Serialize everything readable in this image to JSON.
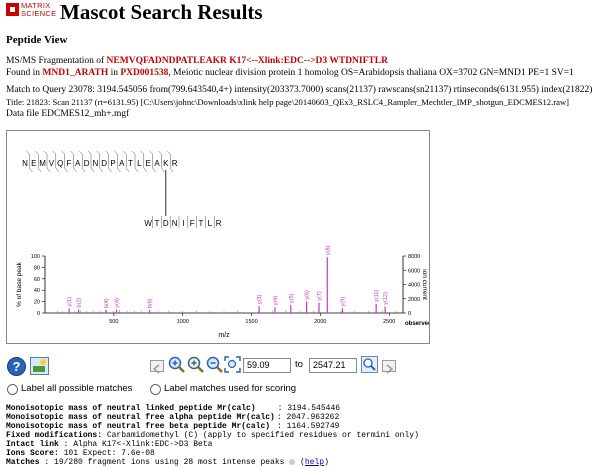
{
  "header": {
    "logo_line1": "MATRIX",
    "logo_line2": "SCIENCE",
    "title": "Mascot Search Results"
  },
  "section_title": "Peptide View",
  "info": {
    "frag_prefix": "MS/MS Fragmentation of ",
    "frag_peptide": "NEMVQFADNDPATLEAKR K17<--Xlink:EDC-->D3 WTDNIFTLR",
    "found_prefix": "Found in ",
    "found_protein": "MND1_ARATH",
    "found_in": " in ",
    "found_acc": "PXD001538",
    "found_desc": ", Meiotic nuclear division protein 1 homolog OS=Arabidopsis thaliana OX=3702 GN=MND1 PE=1 SV=1",
    "query_line": "Match to Query 23078: 3194.545056 from(799.643540,4+) intensity(203373.7000) scans(21137) rawscans(sn21137) rtinseconds(6131.955) index(21822)",
    "title_line": "Title: 21823: Scan 21137 (rt=6131.95) [C:\\Users\\johnc\\Downloads\\xlink help page\\20140603_QEx3_RSLC4_Rampler_Mechtler_IMP_shotgun_EDCMES12.raw]",
    "datafile_line": "Data file EDCMES12_mh+.mgf"
  },
  "sequence": {
    "alpha": [
      "N",
      "E",
      "M",
      "V",
      "Q",
      "F",
      "A",
      "D",
      "N",
      "D",
      "P",
      "A",
      "T",
      "L",
      "E",
      "A",
      "K",
      "R"
    ],
    "beta": [
      "W",
      "T",
      "D",
      "N",
      "I",
      "F",
      "T",
      "L",
      "R"
    ]
  },
  "chart_data": {
    "type": "bar",
    "xlabel": "m/z",
    "ylabel": "% of base peak",
    "y2label": "ion current",
    "y2note": "observed",
    "xlim": [
      0,
      2600
    ],
    "ylim": [
      0,
      100
    ],
    "y2lim": [
      0,
      8000
    ],
    "xticks": [
      500,
      1000,
      1500,
      2000,
      2500
    ],
    "yticks": [
      0,
      20,
      40,
      60,
      80,
      100
    ],
    "y2ticks": [
      0,
      2000,
      4000,
      6000,
      8000
    ],
    "peaks": [
      {
        "x": 90,
        "y": 4
      },
      {
        "x": 130,
        "y": 3
      },
      {
        "x": 175,
        "y": 5
      },
      {
        "x": 215,
        "y": 3
      },
      {
        "x": 260,
        "y": 4
      },
      {
        "x": 300,
        "y": 3
      },
      {
        "x": 350,
        "y": 4
      },
      {
        "x": 400,
        "y": 3
      },
      {
        "x": 440,
        "y": 6
      },
      {
        "x": 500,
        "y": 4
      },
      {
        "x": 540,
        "y": 5
      },
      {
        "x": 600,
        "y": 3
      },
      {
        "x": 650,
        "y": 4
      },
      {
        "x": 700,
        "y": 3
      },
      {
        "x": 760,
        "y": 5
      },
      {
        "x": 820,
        "y": 3
      },
      {
        "x": 900,
        "y": 4
      },
      {
        "x": 1000,
        "y": 3
      },
      {
        "x": 1100,
        "y": 4
      },
      {
        "x": 1200,
        "y": 3
      },
      {
        "x": 1300,
        "y": 3
      },
      {
        "x": 1400,
        "y": 4
      },
      {
        "x": 1550,
        "y": 3
      },
      {
        "x": 1650,
        "y": 4
      },
      {
        "x": 1750,
        "y": 5
      },
      {
        "x": 1850,
        "y": 3
      },
      {
        "x": 1950,
        "y": 4
      },
      {
        "x": 2150,
        "y": 3
      },
      {
        "x": 2250,
        "y": 4
      },
      {
        "x": 2350,
        "y": 3
      },
      {
        "x": 2450,
        "y": 4
      },
      {
        "x": 2550,
        "y": 3
      }
    ],
    "matched": [
      {
        "label": "y(1)",
        "x": 175,
        "y": 8
      },
      {
        "label": "b(2)",
        "x": 244,
        "y": 6
      },
      {
        "label": "b(4)",
        "x": 444,
        "y": 5
      },
      {
        "label": "y(4)",
        "x": 520,
        "y": 6
      },
      {
        "label": "b(6)",
        "x": 760,
        "y": 5
      },
      {
        "label": "y(3)",
        "x": 1555,
        "y": 12
      },
      {
        "label": "y(4)",
        "x": 1670,
        "y": 10
      },
      {
        "label": "y(5)",
        "x": 1785,
        "y": 14
      },
      {
        "label": "y(6)",
        "x": 1900,
        "y": 20
      },
      {
        "label": "y(7)",
        "x": 1990,
        "y": 18
      },
      {
        "label": "y(8)",
        "x": 2050,
        "y": 98
      },
      {
        "label": "y(9)",
        "x": 2160,
        "y": 8
      },
      {
        "label": "y(11)",
        "x": 2405,
        "y": 16
      },
      {
        "label": "y(12)",
        "x": 2470,
        "y": 11
      }
    ],
    "peak_color": "#cc33cc"
  },
  "toolbar": {
    "zoom_from": "59.09",
    "to_label": "to",
    "zoom_to": "2547.21"
  },
  "options": {
    "label_all": "Label all possible matches",
    "label_used": "Label matches used for scoring"
  },
  "stats": {
    "l1_label": "Monoisotopic mass of neutral linked peptide Mr(calc)",
    "l1_value": ": 3194.545446",
    "l2_label": "Monoisotopic mass of neutral free alpha peptide Mr(calc)",
    "l2_value": ": 2047.963262",
    "l3_label": "Monoisotopic mass of neutral free beta peptide Mr(calc)",
    "l3_value": ": 1164.592749",
    "l4_label": "Fixed modifications:",
    "l4_value": " Carbamidomethyl (C) (apply to specified residues or termini only)",
    "l5_label": "Intact link",
    "l5_value": " : Alpha K17<-Xlink:EDC->D3 Beta",
    "l6_label": "Ions Score:",
    "l6_value": " 101  Expect: 7.6e-08",
    "l7_label": "Matches",
    "l7_value": " : 19/280 fragment ions using 28 most intense peaks",
    "help": "help"
  }
}
